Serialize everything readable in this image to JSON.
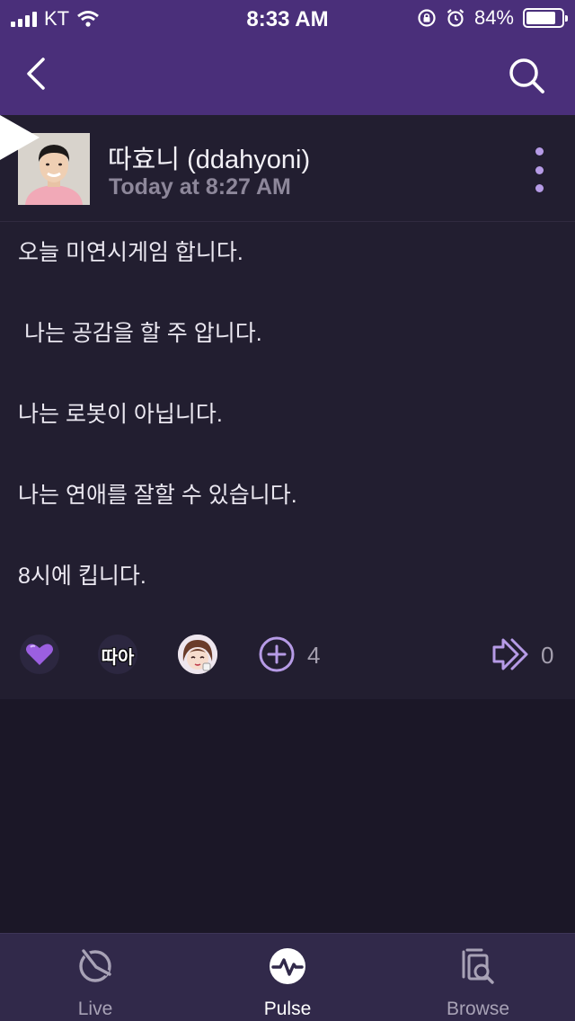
{
  "status_bar": {
    "carrier": "KT",
    "time": "8:33 AM",
    "battery": "84%",
    "battery_level": 0.84
  },
  "nav": {
    "back_icon": "chevron-left-icon",
    "search_icon": "search-icon"
  },
  "post": {
    "author": "따효니 (ddahyoni)",
    "timestamp": "Today at 8:27 AM",
    "lines": [
      "오늘 미연시게임 합니다.",
      "",
      " 나는 공감을 할 주 압니다.",
      "",
      "나는 로봇이 아닙니다.",
      "",
      "나는 연애를 잘할 수 있습니다.",
      "",
      "8시에 킵니다."
    ],
    "reactions": {
      "emote_text": "따아",
      "count": "4",
      "share_count": "0"
    }
  },
  "tabs": [
    {
      "label": "Live",
      "icon": "live-icon"
    },
    {
      "label": "Pulse",
      "icon": "pulse-icon"
    },
    {
      "label": "Browse",
      "icon": "browse-icon"
    }
  ],
  "colors": {
    "brand": "#4a2f7a",
    "accent": "#b69be6",
    "background": "#1b1727",
    "card": "#221e30"
  }
}
